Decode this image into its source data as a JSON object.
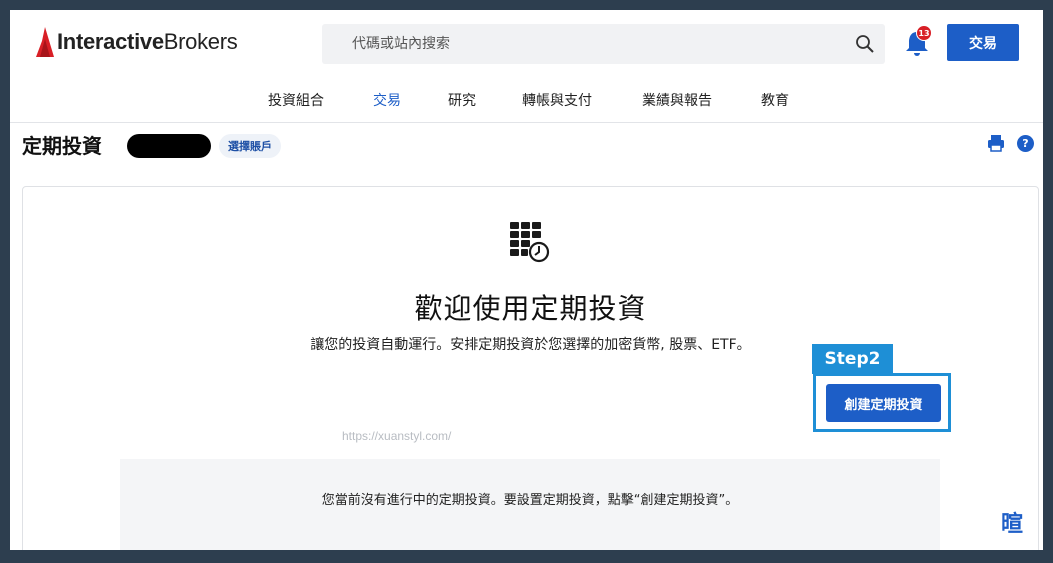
{
  "header": {
    "logo_prefix": "Interactive",
    "logo_suffix": "Brokers",
    "search_placeholder": "代碼或站內搜索",
    "notification_count": "13",
    "trade_button": "交易"
  },
  "nav": {
    "items": [
      {
        "label": "投資組合",
        "active": false
      },
      {
        "label": "交易",
        "active": true
      },
      {
        "label": "研究",
        "active": false
      },
      {
        "label": "轉帳與支付",
        "active": false
      },
      {
        "label": "業績與報告",
        "active": false
      },
      {
        "label": "教育",
        "active": false
      }
    ]
  },
  "page": {
    "title": "定期投資",
    "select_account": "選擇賬戶",
    "help_label": "?"
  },
  "main": {
    "welcome_title": "歡迎使用定期投資",
    "welcome_subtitle": "讓您的投資自動運行。安排定期投資於您選擇的加密貨幣, 股票、ETF。",
    "step_label": "Step2",
    "create_button": "創建定期投資",
    "watermark": "https://xuanstyl.com/",
    "empty_message": "您當前沒有進行中的定期投資。要設置定期投資，點擊“創建定期投資”。"
  },
  "corner_mark": "暄",
  "colors": {
    "brand_blue": "#1d5ec7",
    "annotation_blue": "#1e8fd6",
    "badge_red": "#d81f26",
    "logo_red": "#d81f26"
  }
}
